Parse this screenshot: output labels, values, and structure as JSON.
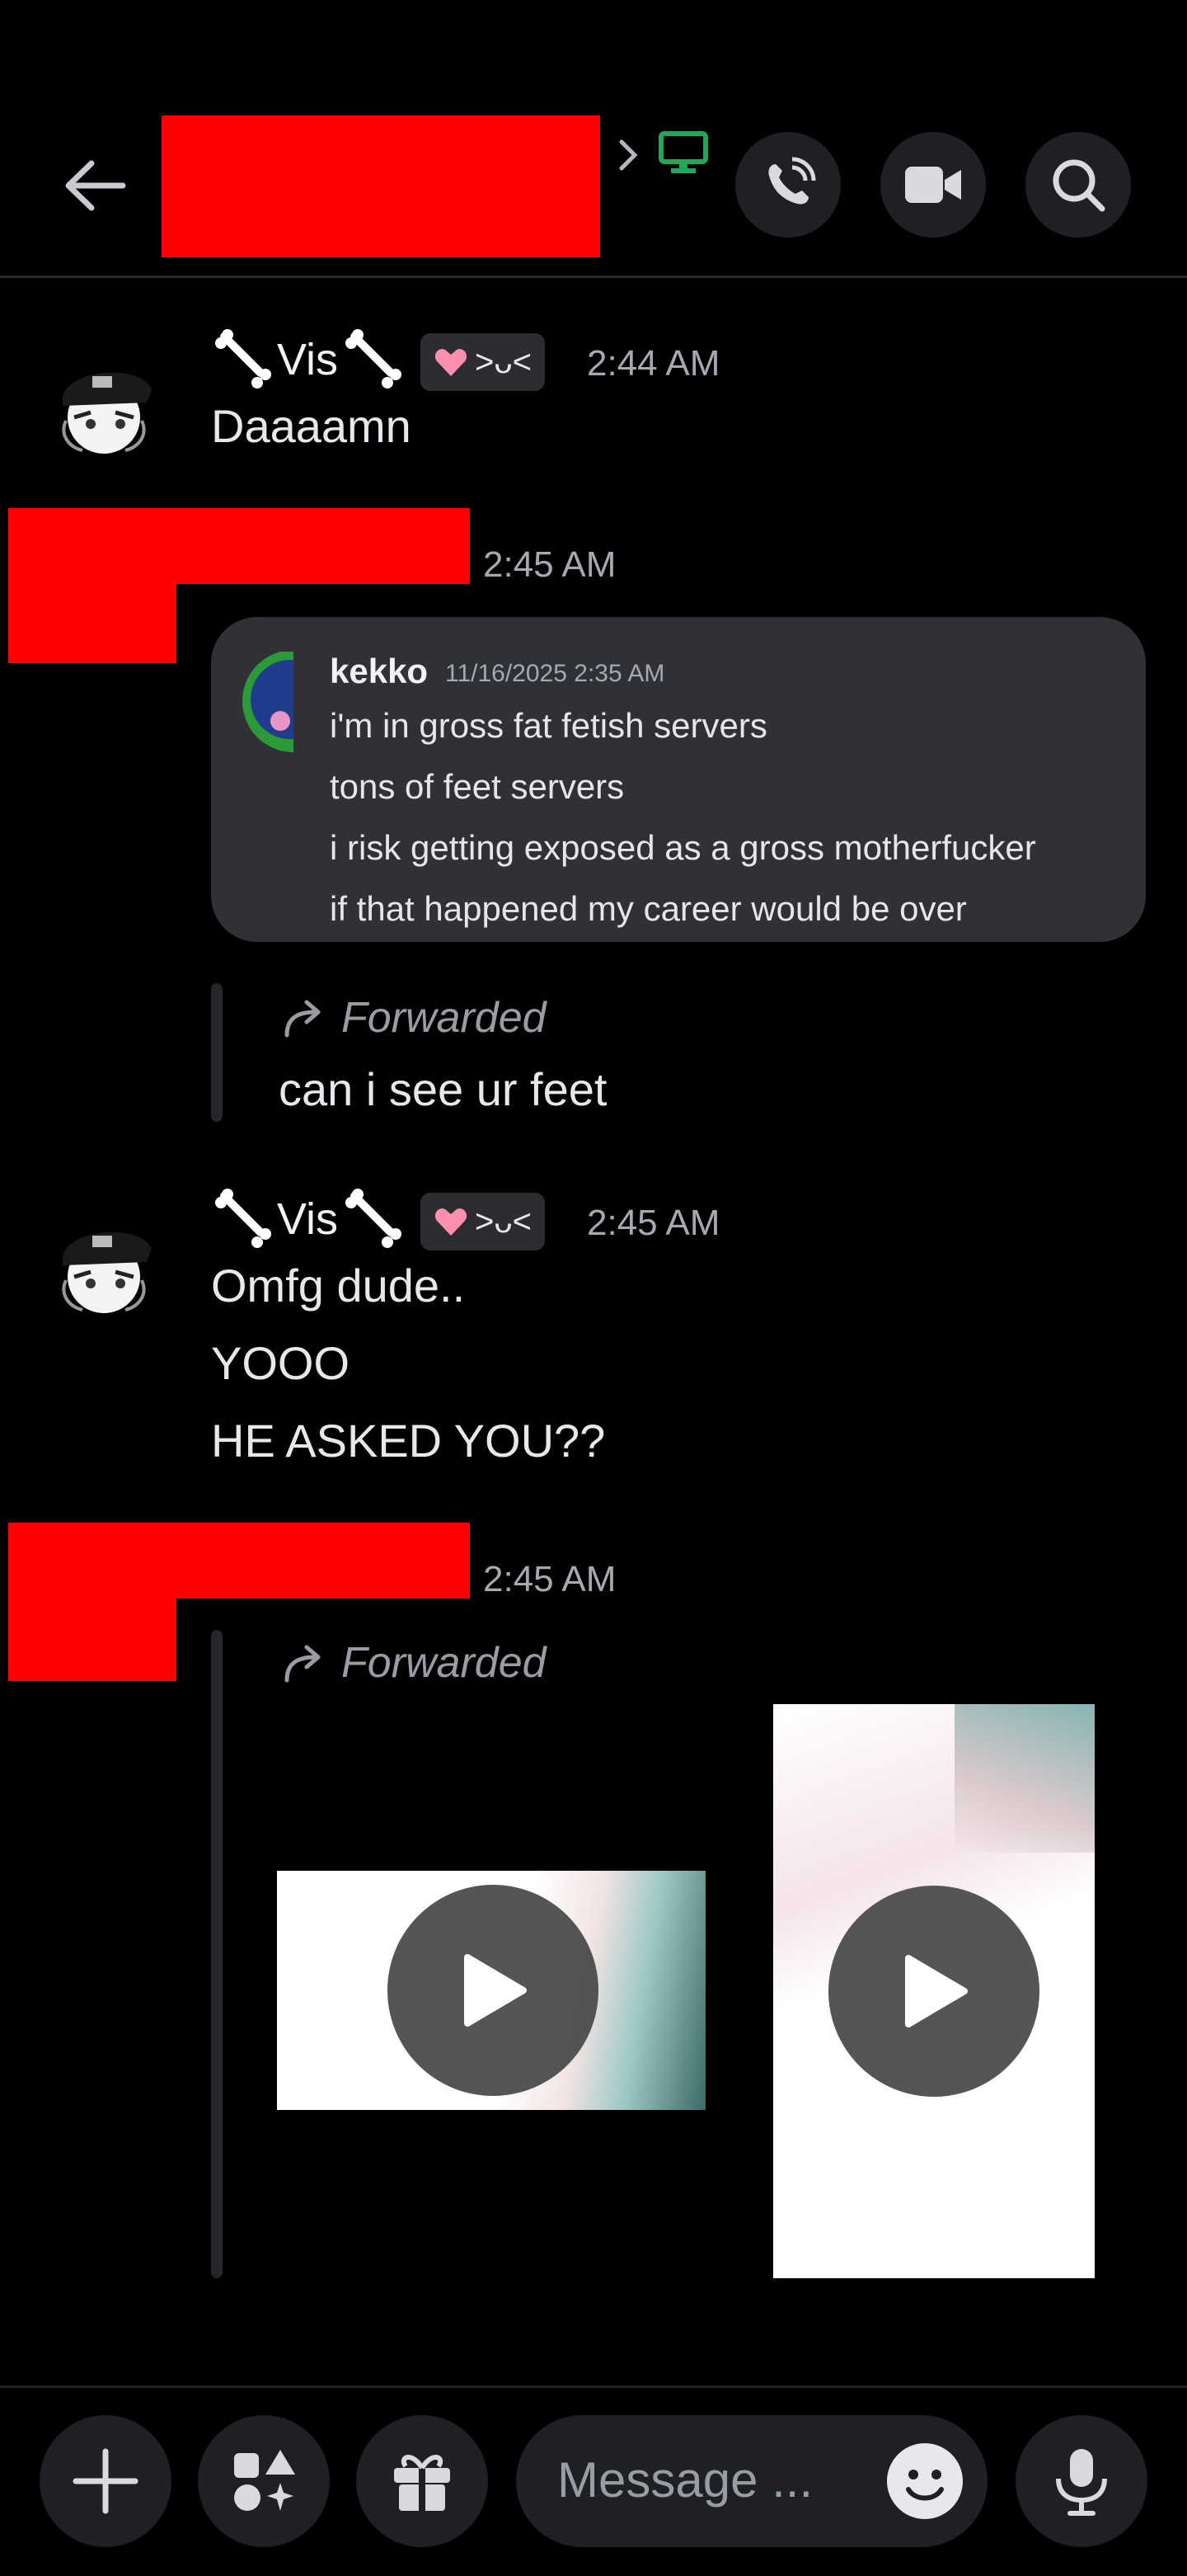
{
  "header": {
    "back_icon": "arrow-left-icon",
    "status_icon": "monitor-icon",
    "status_color": "#23a55a",
    "actions": [
      "phone-icon",
      "video-camera-icon",
      "search-icon"
    ]
  },
  "messages": [
    {
      "author": "Vis",
      "tag_text": ">ᴗ<",
      "time": "2:44 AM",
      "lines": [
        "Daaaamn"
      ]
    },
    {
      "time": "2:45 AM",
      "quote": {
        "author": "kekko",
        "date": "11/16/2025 2:35 AM",
        "lines": [
          "i'm in gross fat fetish servers",
          "tons of feet servers",
          "i risk getting exposed as a gross motherfucker",
          "if that happened my career would be over"
        ]
      },
      "forward": {
        "label": "Forwarded",
        "text": "can i see ur feet"
      }
    },
    {
      "author": "Vis",
      "tag_text": ">ᴗ<",
      "time": "2:45 AM",
      "lines": [
        "Omfg dude..",
        "YOOO",
        "HE ASKED YOU??"
      ]
    },
    {
      "time": "2:45 AM",
      "forward": {
        "label": "Forwarded",
        "media": [
          "video",
          "video"
        ]
      }
    }
  ],
  "composer": {
    "placeholder": "Message ...",
    "buttons": [
      "plus-icon",
      "apps-icon",
      "gift-icon",
      "emoji-icon",
      "microphone-icon"
    ]
  }
}
